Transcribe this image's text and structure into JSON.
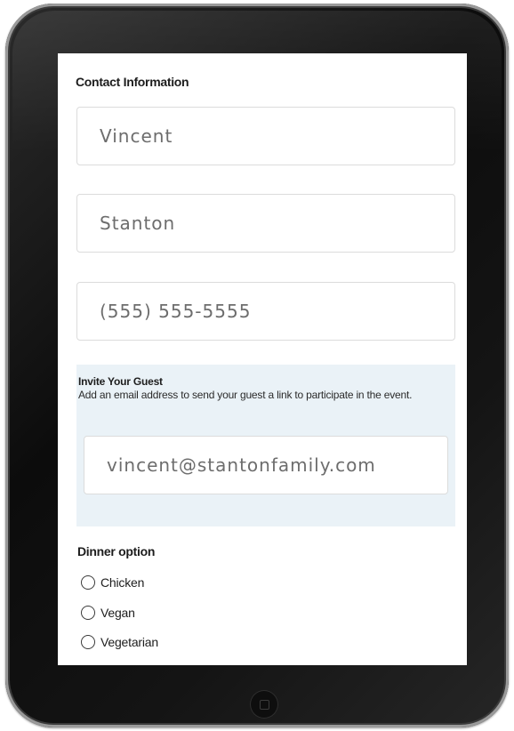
{
  "contact": {
    "heading": "Contact Information",
    "first_name": "Vincent",
    "last_name": "Stanton",
    "phone": "(555) 555-5555"
  },
  "invite": {
    "heading": "Invite Your Guest",
    "description": "Add an email address to send your guest a link to participate in the event.",
    "email": "vincent@stantonfamily.com"
  },
  "dinner": {
    "heading": "Dinner option",
    "options": [
      "Chicken",
      "Vegan",
      "Vegetarian"
    ]
  }
}
